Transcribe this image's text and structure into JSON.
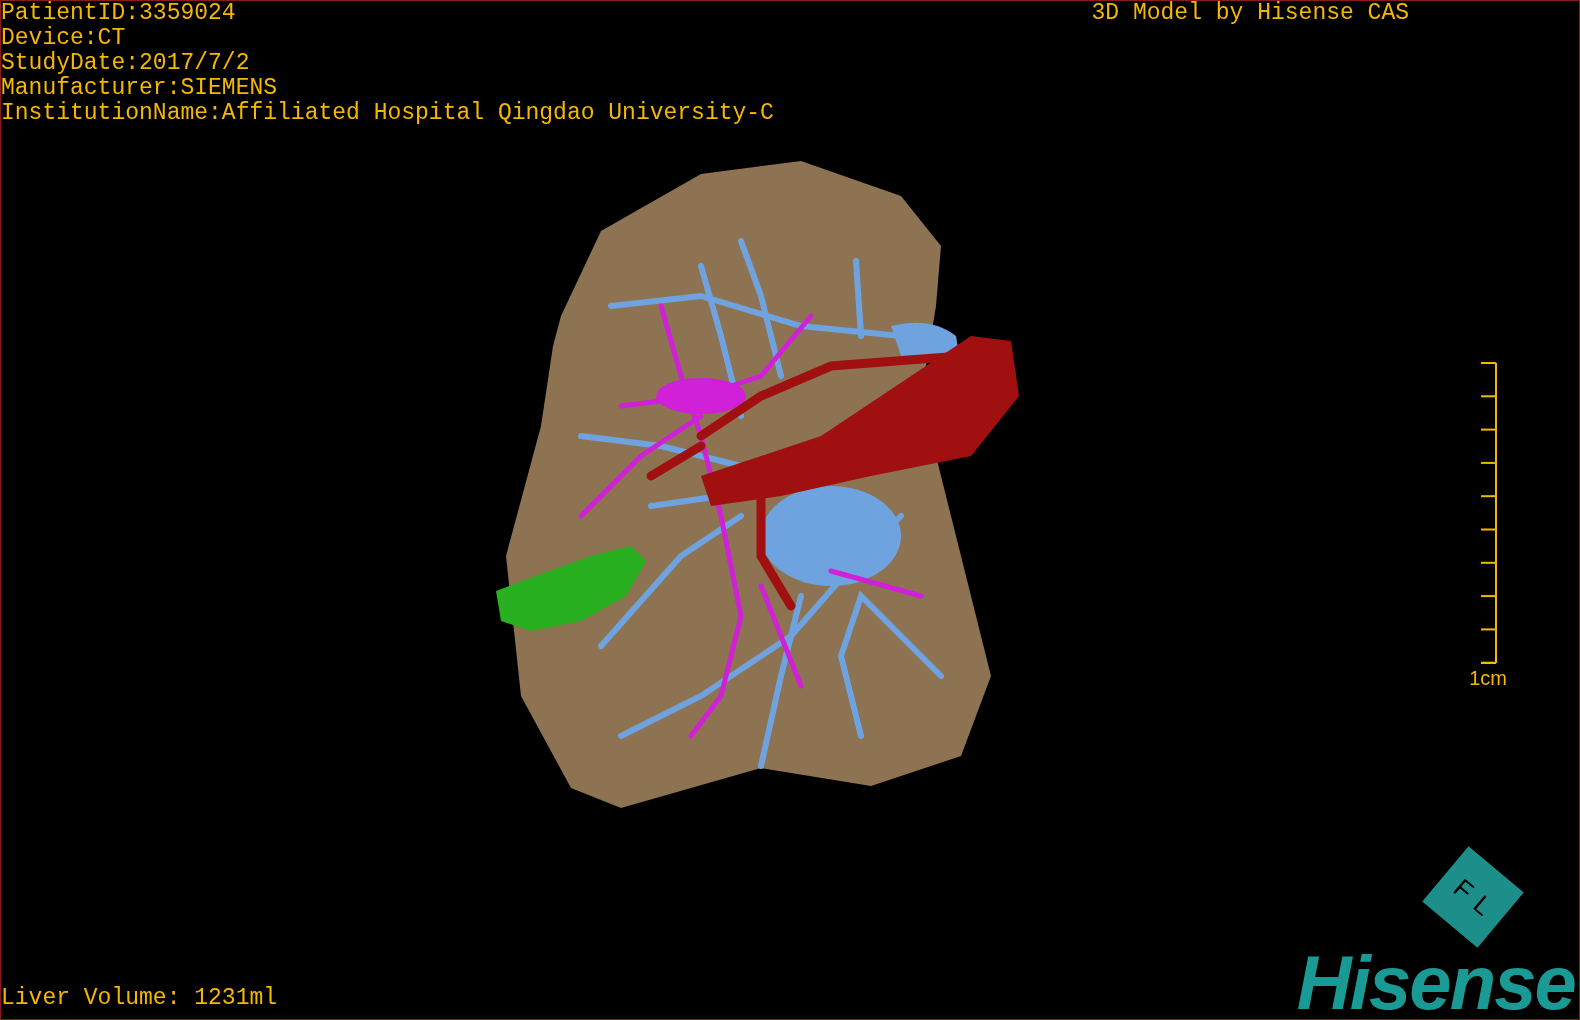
{
  "study_info": [
    "PatientID:3359024",
    "Device:CT",
    "StudyDate:2017/7/2",
    "Manufacturer:SIEMENS",
    "InstitutionName:Affiliated Hospital Qingdao University-C"
  ],
  "title": "3D Model by Hisense CAS",
  "scale_bar": {
    "label": "1cm"
  },
  "orientation_cube": {
    "faces": [
      "F",
      "L"
    ]
  },
  "liver_volume": "Liver Volume: 1231ml",
  "logo": "Hisense"
}
